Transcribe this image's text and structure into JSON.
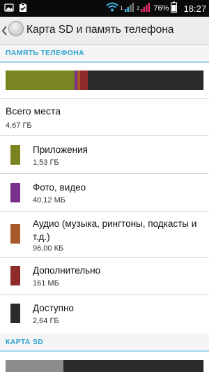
{
  "statusbar": {
    "battery_percent": "76%",
    "time": "18:27",
    "sim1": "1",
    "sim2": "2"
  },
  "actionbar": {
    "title": "Карта SD и память телефона"
  },
  "phone_memory": {
    "header": "ПАМЯТЬ ТЕЛЕФОНА",
    "total_label": "Всего места",
    "total_value": "4,67 ГБ",
    "categories": [
      {
        "label": "Приложения",
        "value": "1,53 ГБ",
        "color": "#7a8420"
      },
      {
        "label": "Фото, видео",
        "value": "40,12 МБ",
        "color": "#7b2f8c"
      },
      {
        "label": "Аудио (музыка, рингтоны, подкасты и т.д.)",
        "value": "96,00 КБ",
        "color": "#a85a2a"
      },
      {
        "label": "Дополнительно",
        "value": "161 МБ",
        "color": "#8f2b2b"
      },
      {
        "label": "Доступно",
        "value": "2,64 ГБ",
        "color": "#2b2b2b"
      }
    ]
  },
  "sd_card": {
    "header": "КАРТА SD",
    "used_color": "#8c8c8c",
    "free_color": "#2b2b2b"
  }
}
